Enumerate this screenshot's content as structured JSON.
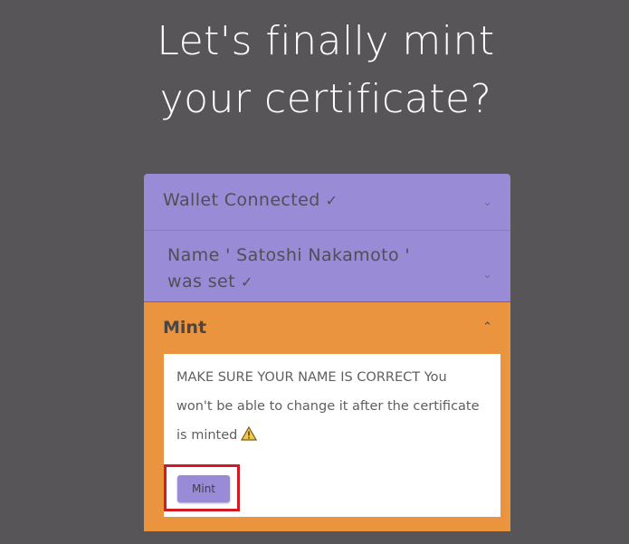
{
  "heading": {
    "line1": "Let's finally mint",
    "line2": "your certificate?"
  },
  "steps": [
    {
      "label": "Wallet Connected",
      "check": "✓",
      "chevron": "chevron-down-icon"
    },
    {
      "label_line1": "Name ' Satoshi Nakamoto '",
      "label_line2": "was set",
      "check": "✓",
      "chevron": "chevron-down-icon"
    }
  ],
  "mint": {
    "title": "Mint",
    "chevron": "chevron-up-icon",
    "warning_line1": "MAKE SURE YOUR NAME IS CORRECT You",
    "warning_line2": "won't be able to change it after the certificate",
    "warning_line3": "is minted",
    "warning_icon": "warning-icon",
    "button_label": "Mint"
  },
  "colors": {
    "background": "#585558",
    "completed_step": "#9a8bd6",
    "active_step": "#eb9440",
    "highlight_border": "#d11a22"
  }
}
